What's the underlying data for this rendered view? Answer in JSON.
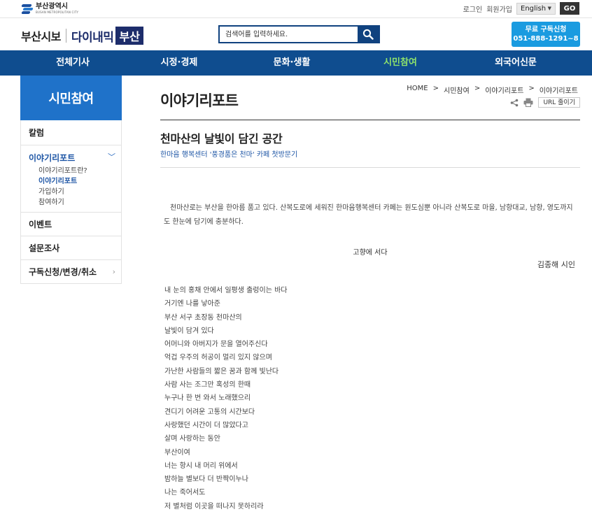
{
  "topbar": {
    "city_name": "부산광역시",
    "city_name_en": "BUSAN METROPOLITAN CITY",
    "login": "로그인",
    "signup": "회원가입",
    "lang": "English",
    "go": "GO"
  },
  "header": {
    "brand_left": "부산시보",
    "brand_mid": "다이내믹",
    "brand_right": "부산",
    "search_placeholder": "검색어를 입력하세요.",
    "subscribe_line1": "무료 구독신청",
    "subscribe_line2": "051-888-1291~8"
  },
  "nav": [
    "전체기사",
    "시정·경제",
    "문화·생활",
    "시민참여",
    "외국어신문"
  ],
  "sidebar": {
    "title": "시민참여",
    "items": [
      {
        "label": "칼럼"
      },
      {
        "label": "이야기리포트",
        "sub": [
          "이야기리포트란?",
          "이야기리포트",
          "가입하기",
          "참여하기"
        ]
      },
      {
        "label": "이벤트"
      },
      {
        "label": "설문조사"
      },
      {
        "label": "구독신청/변경/취소"
      }
    ]
  },
  "main": {
    "page_title": "이야기리포트",
    "breadcrumb": [
      "HOME",
      ">",
      "시민참여",
      ">",
      "이야기리포트",
      ">",
      "이야기리포트"
    ],
    "url_copy": "URL 줄이기",
    "article_title": "천마산의 날빛이 담긴 공간",
    "article_sub": "한마음 행복센터 '풍경품은 천마' 카페 첫방문기",
    "intro": "천마산로는 부산을 한아름 품고 있다. 산복도로에 세워진 한마음행복센터 카페는 원도심뿐 아니라 산복도로 마을, 남항대교, 남항, 영도까지도 한눈에 담기에 충분하다.",
    "poem_title": "고향에 서다",
    "poem_author": "김종해 시인",
    "poem_lines": [
      "내 눈의 홍채 안에서 일평생 출렁이는 바다",
      "거기엔 나를 낳아준",
      "부산 서구 초장동 천마산의",
      "날빛이 담겨 있다",
      "어머니와 아버지가 문을 열어주신다",
      "억겁 우주의 허공이 멀리 있지 않으며",
      "가난한 사람들의 짧은 꿈과 함께 빛난다",
      "사람 사는 조그만 혹성의 한때",
      "누구나 한 번 와서 노래했으리",
      "견디기 어려운 고통의 시간보다",
      "사랑했던 시간이 더 많았다고",
      "살며 사랑하는 동안",
      "부산이여",
      "너는 항시 내 머리 위에서",
      "밤하늘 별보다 더 반짝이누나",
      "나는 죽어서도",
      "저 별처럼 이곳을 떠나지 못하리라"
    ]
  },
  "colors": {
    "nav_bg": "#0f4d8f",
    "nav_active": "#8fe36b",
    "sidebar_title_bg": "#1f72c9",
    "subscribe_bg": "#1a9be0",
    "search_border": "#10427f",
    "link_blue": "#1d55a5"
  },
  "icons": [
    "city-logo-icon",
    "search-icon",
    "share-icon",
    "print-icon",
    "chevron-down-icon",
    "chevron-right-icon"
  ]
}
